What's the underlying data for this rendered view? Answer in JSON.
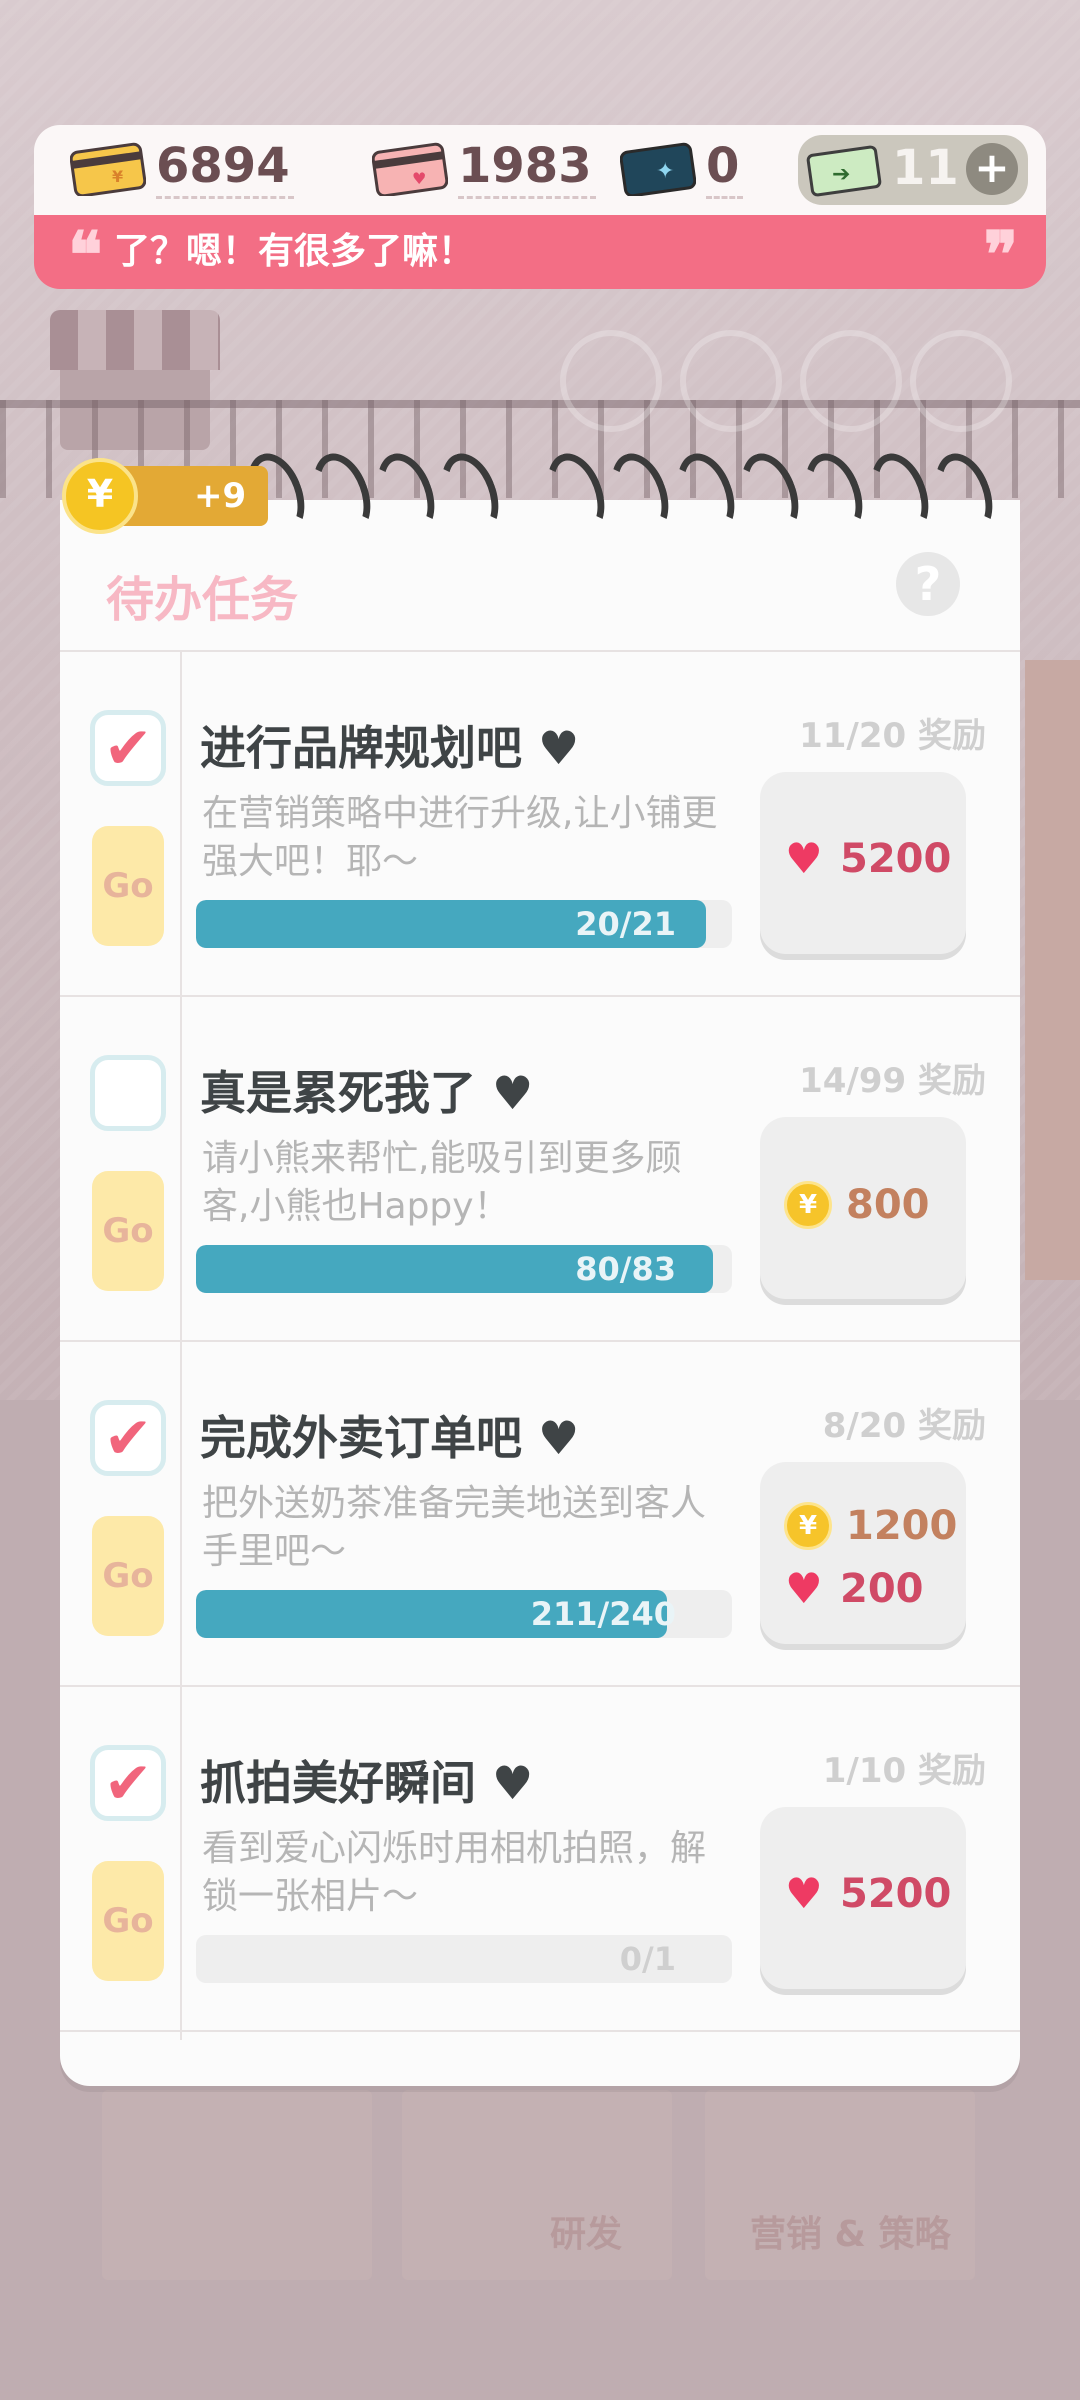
{
  "currencies": {
    "gold_card": "6894",
    "heart_card": "1983",
    "blue_card": "0",
    "ticket": "11"
  },
  "banner": {
    "text": "了？嗯！有很多了嘛！",
    "quote_open": "❝",
    "quote_close": "❞"
  },
  "coin_badge": "+9",
  "panel": {
    "title": "待办任务",
    "help": "?"
  },
  "tasks": [
    {
      "checked": true,
      "go": "Go",
      "name": "进行品牌规划吧",
      "desc": "在营销策略中进行升级,让小铺更强大吧！耶～",
      "progress_text": "20/21",
      "progress": 0.952,
      "reward_head": "11/20 奖励",
      "rewards": [
        {
          "type": "heart",
          "value": "5200"
        }
      ]
    },
    {
      "checked": false,
      "go": "Go",
      "name": "真是累死我了",
      "desc": "请小熊来帮忙,能吸引到更多顾客,小熊也Happy！",
      "progress_text": "80/83",
      "progress": 0.964,
      "reward_head": "14/99 奖励",
      "rewards": [
        {
          "type": "coin",
          "value": "800"
        }
      ]
    },
    {
      "checked": true,
      "go": "Go",
      "name": "完成外卖订单吧",
      "desc": "把外送奶茶准备完美地送到客人手里吧～",
      "progress_text": "211/240",
      "progress": 0.879,
      "reward_head": "8/20 奖励",
      "rewards": [
        {
          "type": "coin",
          "value": "1200"
        },
        {
          "type": "heart",
          "value": "200"
        }
      ]
    },
    {
      "checked": true,
      "go": "Go",
      "name": "抓拍美好瞬间",
      "desc": "看到爱心闪烁时用相机拍照，解锁一张相片～",
      "progress_text": "0/1",
      "progress": 0,
      "reward_head": "1/10 奖励",
      "rewards": [
        {
          "type": "heart",
          "value": "5200"
        }
      ]
    }
  ],
  "bg_tabs": [
    "研发",
    "营销 & 策略"
  ],
  "colors": {
    "accent_pink": "#f36e85",
    "progress_teal": "#45a8bf",
    "go_yellow": "#fde9a8"
  }
}
